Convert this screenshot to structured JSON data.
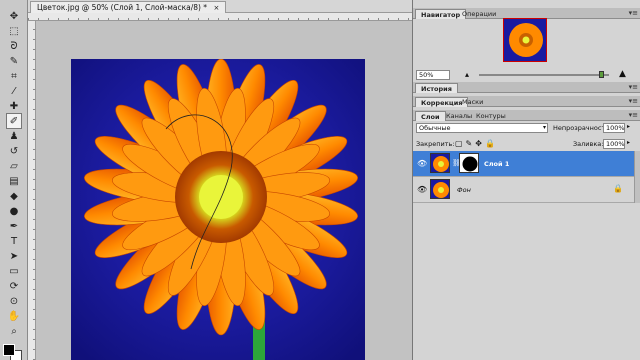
{
  "document": {
    "tab_title": "Цветок.jpg @ 50% (Слой 1, Слой-маска/8) *",
    "close_glyph": "×"
  },
  "toolbox": {
    "tools": [
      {
        "name": "move-tool-icon",
        "glyph": "✥"
      },
      {
        "name": "marquee-tool-icon",
        "glyph": "⬚"
      },
      {
        "name": "lasso-tool-icon",
        "glyph": "ᘐ"
      },
      {
        "name": "quick-select-tool-icon",
        "glyph": "✎"
      },
      {
        "name": "crop-tool-icon",
        "glyph": "⌗"
      },
      {
        "name": "eyedropper-tool-icon",
        "glyph": "⁄"
      },
      {
        "name": "healing-brush-tool-icon",
        "glyph": "✚"
      },
      {
        "name": "brush-tool-icon",
        "glyph": "✐"
      },
      {
        "name": "clone-stamp-tool-icon",
        "glyph": "♟"
      },
      {
        "name": "history-brush-tool-icon",
        "glyph": "↺"
      },
      {
        "name": "eraser-tool-icon",
        "glyph": "▱"
      },
      {
        "name": "gradient-tool-icon",
        "glyph": "▤"
      },
      {
        "name": "blur-tool-icon",
        "glyph": "◆"
      },
      {
        "name": "dodge-tool-icon",
        "glyph": "●"
      },
      {
        "name": "pen-tool-icon",
        "glyph": "✒"
      },
      {
        "name": "type-tool-icon",
        "glyph": "T"
      },
      {
        "name": "path-select-tool-icon",
        "glyph": "➤"
      },
      {
        "name": "shape-tool-icon",
        "glyph": "▭"
      },
      {
        "name": "3d-rotate-tool-icon",
        "glyph": "⟳"
      },
      {
        "name": "3d-orbit-tool-icon",
        "glyph": "⊙"
      },
      {
        "name": "hand-tool-icon",
        "glyph": "✋"
      },
      {
        "name": "zoom-tool-icon",
        "glyph": "⌕"
      }
    ],
    "active_index": 7
  },
  "navigator": {
    "tabs": [
      "Навигатор",
      "Операции"
    ],
    "zoom_value": "50%"
  },
  "history": {
    "tabs": [
      "История"
    ]
  },
  "adjustments": {
    "tabs": [
      "Коррекция",
      "Маски"
    ]
  },
  "layers": {
    "tabs": [
      "Слои",
      "Каналы",
      "Контуры"
    ],
    "blend_mode": "Обычные",
    "opacity_label": "Непрозрачность:",
    "opacity_value": "100%",
    "lock_label": "Закрепить:",
    "fill_label": "Заливка:",
    "fill_value": "100%",
    "items": [
      {
        "name": "Слой 1",
        "selected": true,
        "has_mask": true
      },
      {
        "name": "Фон",
        "selected": false,
        "locked": true
      }
    ]
  },
  "colors": {
    "canvas_bg": "#1c1ca8",
    "petal": "#ff8a00",
    "selection": "#3f7fd6"
  }
}
